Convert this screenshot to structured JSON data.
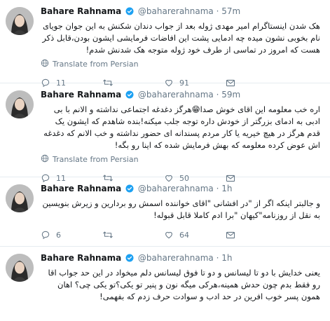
{
  "tweets": [
    {
      "name": "Bahare Rahnama",
      "handle": "@baharerahnama",
      "time": "57m",
      "text": "هک شدن اینستاگرام امیر مهدی ژوله بعد از جواب دندان شکنش به این جوان جویای نام بخوبی نشون میده چه ادمایی پشت این افاضات فرمایشی ایشون بودن،قابل ذکر هست که امروز در تماسی از طرف خود ژوله متوجه هک شدنش شدم!",
      "translate": "Translate from Persian",
      "replies": "11",
      "retweets": "",
      "likes": "91"
    },
    {
      "name": "Bahare Rahnama",
      "handle": "@baharerahnama",
      "time": "59m",
      "text": "اره خب معلومه این اقای خوش صدا😁هرگز دغدغه اجتماعی نداشته و الانم با بی ادبی به ادمای بزرگتر از خودش داره توجه جلب میکنه!بنده شاهدم که ایشون یک قدم هرگز در هیچ خیریه یا کار مردم پسندانه ای حضور نداشته و خب الانم که دغدغه اش عوض کرده معلومه که بهش فرمایش شده که اینا رو بگه!",
      "translate": "Translate from Persian",
      "replies": "11",
      "retweets": "",
      "likes": "50"
    },
    {
      "name": "Bahare Rahnama",
      "handle": "@baharerahnama",
      "time": "1h",
      "text": "و جالبتر اینکه اگر از \"در افشانی \"اقای خواننده اسمش رو بردارین و زیرش بنویسین به نقل از روزنامه\"کیهان \"برا ادم کاملا قابل قبوله!",
      "translate": "",
      "replies": "6",
      "retweets": "",
      "likes": "64"
    },
    {
      "name": "Bahare Rahnama",
      "handle": "@baharerahnama",
      "time": "1h",
      "text": "یعنی خدایش با دو تا لیسانس و دو تا فوق لیسانس دلم میخواد در این حد جواب اقا رو فقط بدم چون حدش همینه،هرکی میگه نون و پنیر تو یکی؟تو یکی چی؟ اهان همون پسر خوب افرین در حد ادب و سوادت حرف زدم که بفهمی!",
      "translate": "",
      "replies": "",
      "retweets": "",
      "likes": ""
    }
  ],
  "colors": {
    "verified": "#1da1f2",
    "muted": "#657786",
    "text": "#14171a",
    "divider": "#e6ecf0"
  },
  "icons": [
    "verified-badge-icon",
    "globe-icon",
    "reply-icon",
    "retweet-icon",
    "like-icon",
    "direct-message-icon"
  ]
}
